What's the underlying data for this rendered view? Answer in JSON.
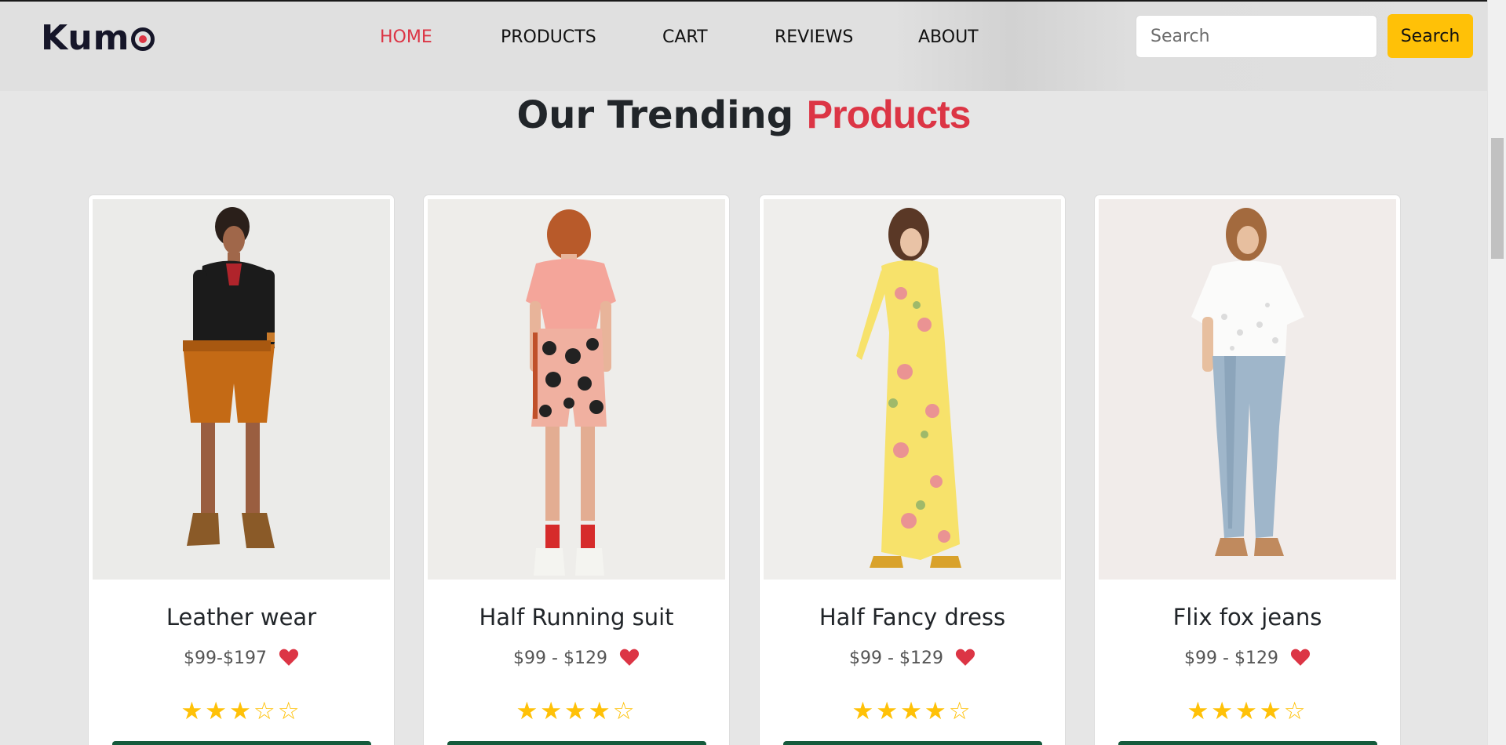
{
  "header": {
    "logo_text": "Kum",
    "nav": [
      {
        "label": "HOME",
        "active": true
      },
      {
        "label": "PRODUCTS",
        "active": false
      },
      {
        "label": "CART",
        "active": false
      },
      {
        "label": "REVIEWS",
        "active": false
      },
      {
        "label": "ABOUT",
        "active": false
      }
    ],
    "search_placeholder": "Search",
    "search_button": "Search"
  },
  "section": {
    "title_main": "Our Trending ",
    "title_accent": "Products"
  },
  "products": [
    {
      "name": "Leather wear",
      "price": "$99-$197",
      "rating": 3,
      "max_rating": 5
    },
    {
      "name": "Half Running suit",
      "price": "$99 - $129",
      "rating": 4,
      "max_rating": 5
    },
    {
      "name": "Half Fancy dress",
      "price": "$99 - $129",
      "rating": 4,
      "max_rating": 5
    },
    {
      "name": "Flix fox jeans",
      "price": "$99 - $129",
      "rating": 4,
      "max_rating": 5
    }
  ],
  "colors": {
    "accent_red": "#dc3545",
    "button_yellow": "#ffc107",
    "star_yellow": "#ffc107",
    "brand_dark": "#161629"
  },
  "icons": [
    "heart-icon",
    "star-icon",
    "star-outline-icon"
  ]
}
